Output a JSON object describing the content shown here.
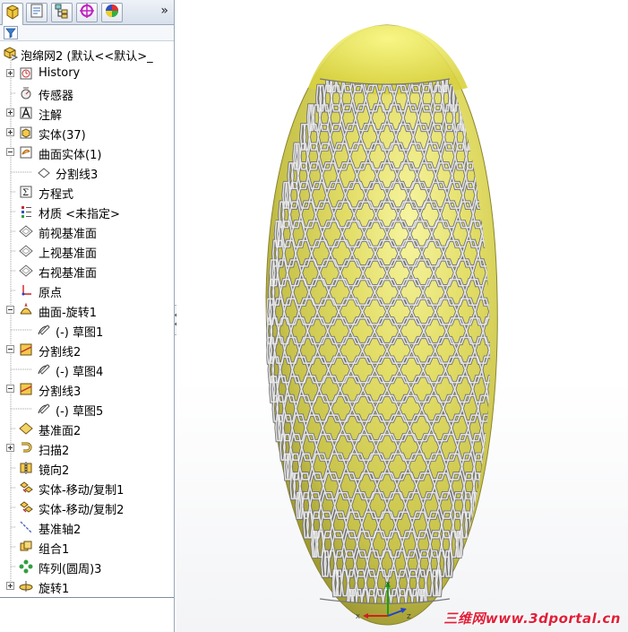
{
  "tabs": [
    {
      "name": "feature-manager",
      "icon": "feature-tree-icon"
    },
    {
      "name": "property-manager",
      "icon": "property-icon"
    },
    {
      "name": "configuration-manager",
      "icon": "configuration-icon"
    },
    {
      "name": "dimxpert-manager",
      "icon": "crosshair-icon"
    },
    {
      "name": "display-manager",
      "icon": "appearance-icon"
    }
  ],
  "tabs_expand": "»",
  "tree": {
    "root": "泡绵网2  (默认<<默认>_",
    "items": [
      {
        "label": "History",
        "icon": "history-icon",
        "expander": "plus"
      },
      {
        "label": "传感器",
        "icon": "sensor-icon",
        "expander": ""
      },
      {
        "label": "注解",
        "icon": "annotation-icon",
        "expander": "plus"
      },
      {
        "label": "实体(37)",
        "icon": "solid-body-icon",
        "expander": "plus"
      },
      {
        "label": "曲面实体(1)",
        "icon": "surface-body-icon",
        "expander": "minus"
      },
      {
        "label": "分割线3",
        "icon": "split-line-icon",
        "expander": "",
        "child": true
      },
      {
        "label": "方程式",
        "icon": "equation-icon",
        "expander": ""
      },
      {
        "label": "材质 <未指定>",
        "icon": "material-icon",
        "expander": ""
      },
      {
        "label": "前视基准面",
        "icon": "plane-icon",
        "expander": ""
      },
      {
        "label": "上视基准面",
        "icon": "plane-icon",
        "expander": ""
      },
      {
        "label": "右视基准面",
        "icon": "plane-icon",
        "expander": ""
      },
      {
        "label": "原点",
        "icon": "origin-icon",
        "expander": ""
      },
      {
        "label": "曲面-旋转1",
        "icon": "revolve-surface-icon",
        "expander": "minus"
      },
      {
        "label": "(-) 草图1",
        "icon": "sketch-icon",
        "expander": "",
        "child": true
      },
      {
        "label": "分割线2",
        "icon": "split-line-feature-icon",
        "expander": "minus"
      },
      {
        "label": "(-) 草图4",
        "icon": "sketch-icon",
        "expander": "",
        "child": true
      },
      {
        "label": "分割线3",
        "icon": "split-line-feature-icon",
        "expander": "minus"
      },
      {
        "label": "(-) 草图5",
        "icon": "sketch-icon",
        "expander": "",
        "child": true
      },
      {
        "label": "基准面2",
        "icon": "ref-plane-icon",
        "expander": ""
      },
      {
        "label": "扫描2",
        "icon": "sweep-icon",
        "expander": "plus"
      },
      {
        "label": "镜向2",
        "icon": "mirror-icon",
        "expander": ""
      },
      {
        "label": "实体-移动/复制1",
        "icon": "move-copy-icon",
        "expander": ""
      },
      {
        "label": "实体-移动/复制2",
        "icon": "move-copy-icon",
        "expander": ""
      },
      {
        "label": "基准轴2",
        "icon": "axis-icon",
        "expander": ""
      },
      {
        "label": "组合1",
        "icon": "combine-icon",
        "expander": ""
      },
      {
        "label": "阵列(圆周)3",
        "icon": "circular-pattern-icon",
        "expander": ""
      },
      {
        "label": "旋转1",
        "icon": "revolve-icon",
        "expander": "plus"
      }
    ]
  },
  "triad": {
    "x": "X",
    "y": "Y",
    "z": "Z"
  },
  "watermark": "三维网www.3dportal.cn",
  "colors": {
    "egg": "#d8d35a",
    "egg_highlight": "#f2f08a",
    "mesh": "#c8c8c8",
    "watermark": "#e0203a"
  }
}
